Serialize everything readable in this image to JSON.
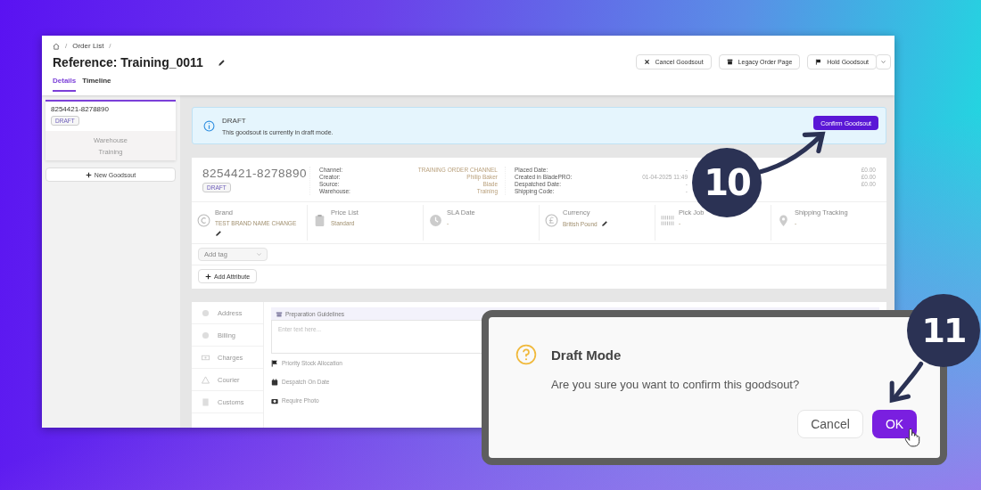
{
  "breadcrumb": [
    {
      "kind": "separator",
      "text": "/"
    },
    {
      "kind": "link",
      "text": "Order List"
    },
    {
      "kind": "separator",
      "text": "/"
    }
  ],
  "title": "Reference: Training_0011",
  "header_buttons": [
    {
      "label": "Cancel Goodsout"
    },
    {
      "label": "Legacy Order Page"
    },
    {
      "label": "Hold Goodsout"
    }
  ],
  "tabs": [
    {
      "label": "Details",
      "selected": true
    },
    {
      "label": "Timeline",
      "selected": false
    }
  ],
  "sidebar": {
    "order": {
      "id": "8254421-8278890",
      "status": "DRAFT",
      "warehouse_label": "Warehouse",
      "warehouse": "Training"
    },
    "new_button": "New Goodsout"
  },
  "alert": {
    "title": "DRAFT",
    "message": "This goodsout is currently in draft mode.",
    "button": "Confirm Goodsout"
  },
  "order": {
    "id": "8254421-8278890",
    "status": "DRAFT",
    "details": [
      {
        "label": "Channel:",
        "value": "TRAINING ORDER CHANNEL"
      },
      {
        "label": "Creator:",
        "value": "Philip Baker"
      },
      {
        "label": "Source:",
        "value": "Blade"
      },
      {
        "label": "Warehouse:",
        "value": "Training"
      }
    ],
    "dates": [
      {
        "label": "Placed Date:",
        "value": "-"
      },
      {
        "label": "Created in BladePRO:",
        "value": "01-04-2025 11:49"
      },
      {
        "label": "Despatched Date:",
        "value": "-"
      },
      {
        "label": "Shipping Code:",
        "value": "-"
      }
    ],
    "totals": [
      "£0.00",
      "£0.00",
      "£0.00"
    ]
  },
  "info_items": [
    {
      "label": "Brand",
      "value": "TEST BRAND NAME CHANGE",
      "editable": true
    },
    {
      "label": "Price List",
      "value": "Standard",
      "editable": false
    },
    {
      "label": "SLA Date",
      "value": "-",
      "editable": false
    },
    {
      "label": "Currency",
      "value": "British Pound",
      "editable": true
    },
    {
      "label": "Pick Job",
      "value": "-",
      "editable": false
    },
    {
      "label": "Shipping Tracking",
      "value": "-",
      "editable": false
    }
  ],
  "tag_select": {
    "placeholder": "Add tag"
  },
  "add_attribute": "Add Attribute",
  "sections": [
    "Address",
    "Billing",
    "Charges",
    "Courier",
    "Customs"
  ],
  "guidelines": {
    "title": "Preparation Guidelines",
    "placeholder": "Enter text here..."
  },
  "options": [
    "Priority Stock Allocation",
    "Despatch On Date",
    "Require Photo"
  ],
  "dialog": {
    "title": "Draft Mode",
    "message": "Are you sure you want to confirm this goodsout?",
    "buttons": [
      {
        "label": "Cancel",
        "kind": "secondary"
      },
      {
        "label": "OK",
        "kind": "primary"
      }
    ]
  },
  "steps": [
    "10",
    "11"
  ]
}
